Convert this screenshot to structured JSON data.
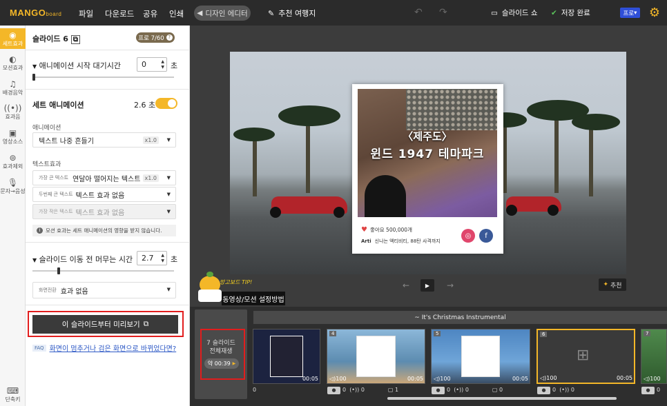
{
  "app": {
    "logo": "MANGO",
    "logo_sub": "board",
    "menus": [
      "파일",
      "다운로드",
      "공유",
      "인쇄"
    ],
    "editor_label": "디자인 에디터",
    "doc_title": "추천 여행지",
    "slideshow": "슬라이드 쇼",
    "saved": "저장 완료",
    "pro": "프로"
  },
  "rail": [
    {
      "label": "세트효과",
      "icon": "set-effect-icon",
      "active": true
    },
    {
      "label": "모션효과",
      "icon": "motion-icon"
    },
    {
      "label": "배경음악",
      "icon": "music-icon"
    },
    {
      "label": "효과음",
      "icon": "sound-effect-icon"
    },
    {
      "label": "영상소스",
      "icon": "video-source-icon"
    },
    {
      "label": "효과제외",
      "icon": "effect-exclude-icon"
    },
    {
      "label": "문자→음성",
      "icon": "microphone-icon"
    },
    {
      "label": "단축키",
      "icon": "keyboard-icon"
    }
  ],
  "panel": {
    "slide_title": "슬라이드 6",
    "pro_count": "프로 7/60",
    "wait_label": "애니메이션 시작 대기시간",
    "wait_value": "0",
    "sec": "초",
    "set_anim_label": "세트 애니메이션",
    "set_anim_value": "2.6 초",
    "set_anim_on": true,
    "anim_label": "애니메이션",
    "anim_value": "텍스트 나중 흔들기",
    "anim_x": "x1.0",
    "text_effect_label": "텍스트효과",
    "te1_small": "가장 큰 텍스트",
    "te1_value": "연달아 떨어지는 텍스트",
    "te1_x": "x1.0",
    "te2_small": "두번째 큰 텍스트",
    "te2_value": "텍스트 효과 없음",
    "te3_small": "가장 작은 텍스트",
    "te3_value": "텍스트 효과 없음",
    "info": "모션 효과는 세트 애니메이션의 영향을 받지 않습니다.",
    "stay_label": "슬라이드 이동 전 머무는 시간",
    "stay_value": "2.7",
    "stay_sec": "초",
    "transition_small": "화면전환",
    "transition_value": "효과 없음",
    "preview_btn": "이 슬라이드부터 미리보기",
    "faq_tag": "FAQ",
    "faq_link": "화면이 멈추거나 검은 화면으로 바뀌었다면?"
  },
  "card": {
    "title1": "〈제주도〉",
    "title2": "윈드 1947 테마파크",
    "likes": "좋아요 500,000개",
    "caption_user": "Arti",
    "caption": "신나는 액티비티, 88탄 사격까지"
  },
  "stage_ctl": {
    "recommend": "추천"
  },
  "tip": {
    "bubble": "망고보드 TIP!",
    "button": "동영상/모션 설정방법"
  },
  "timeline": {
    "music": "~ It's Christmas Instrumental",
    "allplay_line1": "7 슬라이드",
    "allplay_line2": "전체재생",
    "duration": "약 00:39",
    "slides": [
      {
        "num": "",
        "dur": "00:05",
        "vol": "",
        "a": "0",
        "b": "",
        "c": "",
        "bg": "#1c2340"
      },
      {
        "num": "4",
        "dur": "00:05",
        "vol": "100",
        "a": "0",
        "b": "(•)) 0",
        "c": "1",
        "bg": "#7fa8c9"
      },
      {
        "num": "5",
        "dur": "00:05",
        "vol": "100",
        "a": "0",
        "b": "(•)) 0",
        "c": "0",
        "bg": "#5b8fc4"
      },
      {
        "num": "6",
        "dur": "00:05",
        "vol": "100",
        "a": "0",
        "b": "(•)) 0",
        "c": "",
        "bg": "#3a3a3a"
      },
      {
        "num": "7",
        "dur": "",
        "vol": "100",
        "a": "0",
        "b": "",
        "c": "",
        "bg": "#3f6d3d"
      }
    ]
  },
  "colors": {
    "accent": "#f4b728",
    "highlight": "#e21d1d",
    "pro": "#2f4fd8"
  }
}
